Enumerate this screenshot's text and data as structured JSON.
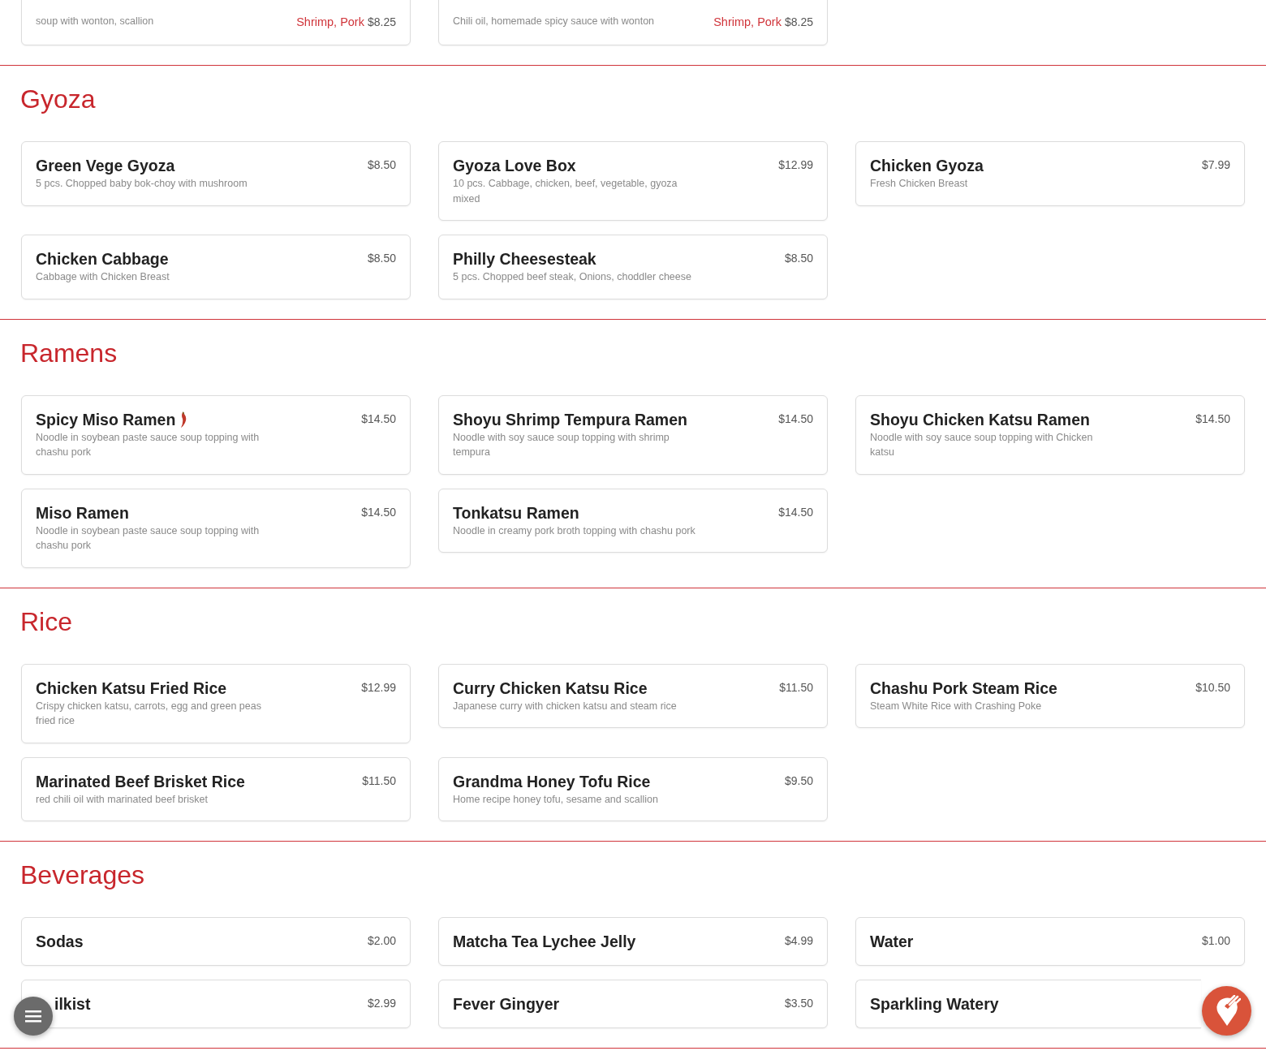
{
  "top_items": [
    {
      "description": "soup with wonton, scallion",
      "price_options": [
        {
          "label": "Shrimp, Pork",
          "price": "$8.25"
        }
      ]
    },
    {
      "description": "Chili oil, homemade spicy sauce with wonton",
      "price_options": [
        {
          "label": "Shrimp, Pork",
          "price": "$8.25"
        }
      ]
    }
  ],
  "sections": [
    {
      "title": "Gyoza",
      "items": [
        {
          "name": "Green Vege Gyoza",
          "description": "5 pcs. Chopped baby bok-choy with mushroom",
          "price": "$8.50",
          "spicy": false
        },
        {
          "name": "Gyoza Love Box",
          "description": "10 pcs. Cabbage, chicken, beef, vegetable, gyoza mixed",
          "price": "$12.99",
          "spicy": false
        },
        {
          "name": "Chicken Gyoza",
          "description": "Fresh Chicken Breast",
          "price": "$7.99",
          "spicy": false
        },
        {
          "name": "Chicken Cabbage",
          "description": "Cabbage with Chicken Breast",
          "price": "$8.50",
          "spicy": false
        },
        {
          "name": "Philly Cheesesteak",
          "description": "5 pcs. Chopped beef steak, Onions, choddler cheese",
          "price": "$8.50",
          "spicy": false
        }
      ]
    },
    {
      "title": "Ramens",
      "items": [
        {
          "name": "Spicy Miso Ramen",
          "description": "Noodle in soybean paste sauce soup topping with chashu pork",
          "price": "$14.50",
          "spicy": true
        },
        {
          "name": "Shoyu Shrimp Tempura Ramen",
          "description": "Noodle with soy sauce soup topping with shrimp tempura",
          "price": "$14.50",
          "spicy": false
        },
        {
          "name": "Shoyu Chicken Katsu Ramen",
          "description": "Noodle with soy sauce soup topping with Chicken katsu",
          "price": "$14.50",
          "spicy": false
        },
        {
          "name": "Miso Ramen",
          "description": "Noodle in soybean paste sauce soup topping with chashu pork",
          "price": "$14.50",
          "spicy": false
        },
        {
          "name": "Tonkatsu Ramen",
          "description": "Noodle in creamy pork broth topping with chashu pork",
          "price": "$14.50",
          "spicy": false
        }
      ]
    },
    {
      "title": "Rice",
      "items": [
        {
          "name": "Chicken Katsu Fried Rice",
          "description": "Crispy chicken katsu, carrots, egg and green peas fried rice",
          "price": "$12.99",
          "spicy": false
        },
        {
          "name": "Curry Chicken Katsu Rice",
          "description": "Japanese curry with chicken katsu and steam rice",
          "price": "$11.50",
          "spicy": false
        },
        {
          "name": "Chashu Pork Steam Rice",
          "description": "Steam White Rice with Crashing Poke",
          "price": "$10.50",
          "spicy": false
        },
        {
          "name": "Marinated Beef Brisket Rice",
          "description": "red chili oil with marinated beef brisket",
          "price": "$11.50",
          "spicy": false
        },
        {
          "name": "Grandma Honey Tofu Rice",
          "description": "Home recipe honey tofu, sesame and scallion",
          "price": "$9.50",
          "spicy": false
        }
      ]
    },
    {
      "title": "Beverages",
      "items": [
        {
          "name": "Sodas",
          "price": "$2.00",
          "spicy": false
        },
        {
          "name": "Matcha Tea Lychee Jelly",
          "price": "$4.99",
          "spicy": false
        },
        {
          "name": "Water",
          "price": "$1.00",
          "spicy": false
        },
        {
          "name": "ilkist",
          "price": "$2.99",
          "spicy": false,
          "kind": "partly_covered"
        },
        {
          "name": "Fever Gingyer",
          "price": "$3.50",
          "spicy": false
        },
        {
          "name": "Sparkling Watery",
          "spicy": false,
          "kind": "clipped"
        }
      ]
    }
  ]
}
